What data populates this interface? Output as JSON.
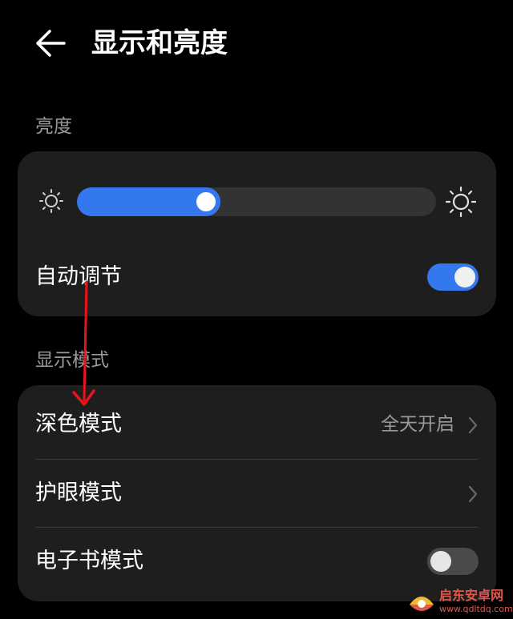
{
  "header": {
    "title": "显示和亮度",
    "back_icon": "back-arrow-icon"
  },
  "brightness": {
    "section_label": "亮度",
    "level_percent": 40,
    "low_icon": "sun-small-icon",
    "high_icon": "sun-large-icon",
    "auto_adjust": {
      "label": "自动调节",
      "on": true
    }
  },
  "display_mode": {
    "section_label": "显示模式",
    "items": [
      {
        "label": "深色模式",
        "value": "全天开启",
        "control": "chevron"
      },
      {
        "label": "护眼模式",
        "value": "",
        "control": "chevron"
      },
      {
        "label": "电子书模式",
        "value": "",
        "control": "toggle",
        "on": false
      }
    ]
  },
  "watermark": {
    "name": "启东安卓网",
    "url": "www.qdltdq.com"
  },
  "colors": {
    "accent": "#3478f0",
    "card": "#1e1e1e",
    "annotation": "#e8141b"
  }
}
